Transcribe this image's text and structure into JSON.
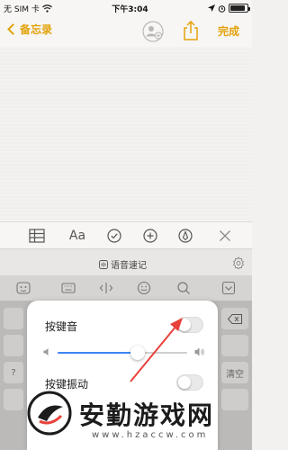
{
  "status_bar": {
    "carrier": "无 SIM 卡",
    "time": "下午3:04",
    "battery_level": 0.9
  },
  "nav": {
    "back_label": "备忘录",
    "done_label": "完成",
    "icons": [
      "chevron-left-icon",
      "add-person-icon",
      "share-icon"
    ]
  },
  "format_toolbar": {
    "text_format_label": "Aa",
    "icons": [
      "table-icon",
      "text-format",
      "checklist-icon",
      "add-icon",
      "markup-icon",
      "close-icon"
    ]
  },
  "voice_bar": {
    "label": "语音速记"
  },
  "keyboard": {
    "partial_keys": [
      "?",
      "清空"
    ]
  },
  "popup": {
    "key_sound_label": "按键音",
    "key_sound_on": false,
    "volume_level": 0.62,
    "key_vibration_label": "按键振动",
    "key_vibration_on": false
  },
  "watermark": {
    "title": "安勤游戏网",
    "url": "www.hzaccw.com"
  },
  "colors": {
    "accent": "#e3a20a",
    "slider": "#3b86f2",
    "arrow": "#e8413b"
  }
}
